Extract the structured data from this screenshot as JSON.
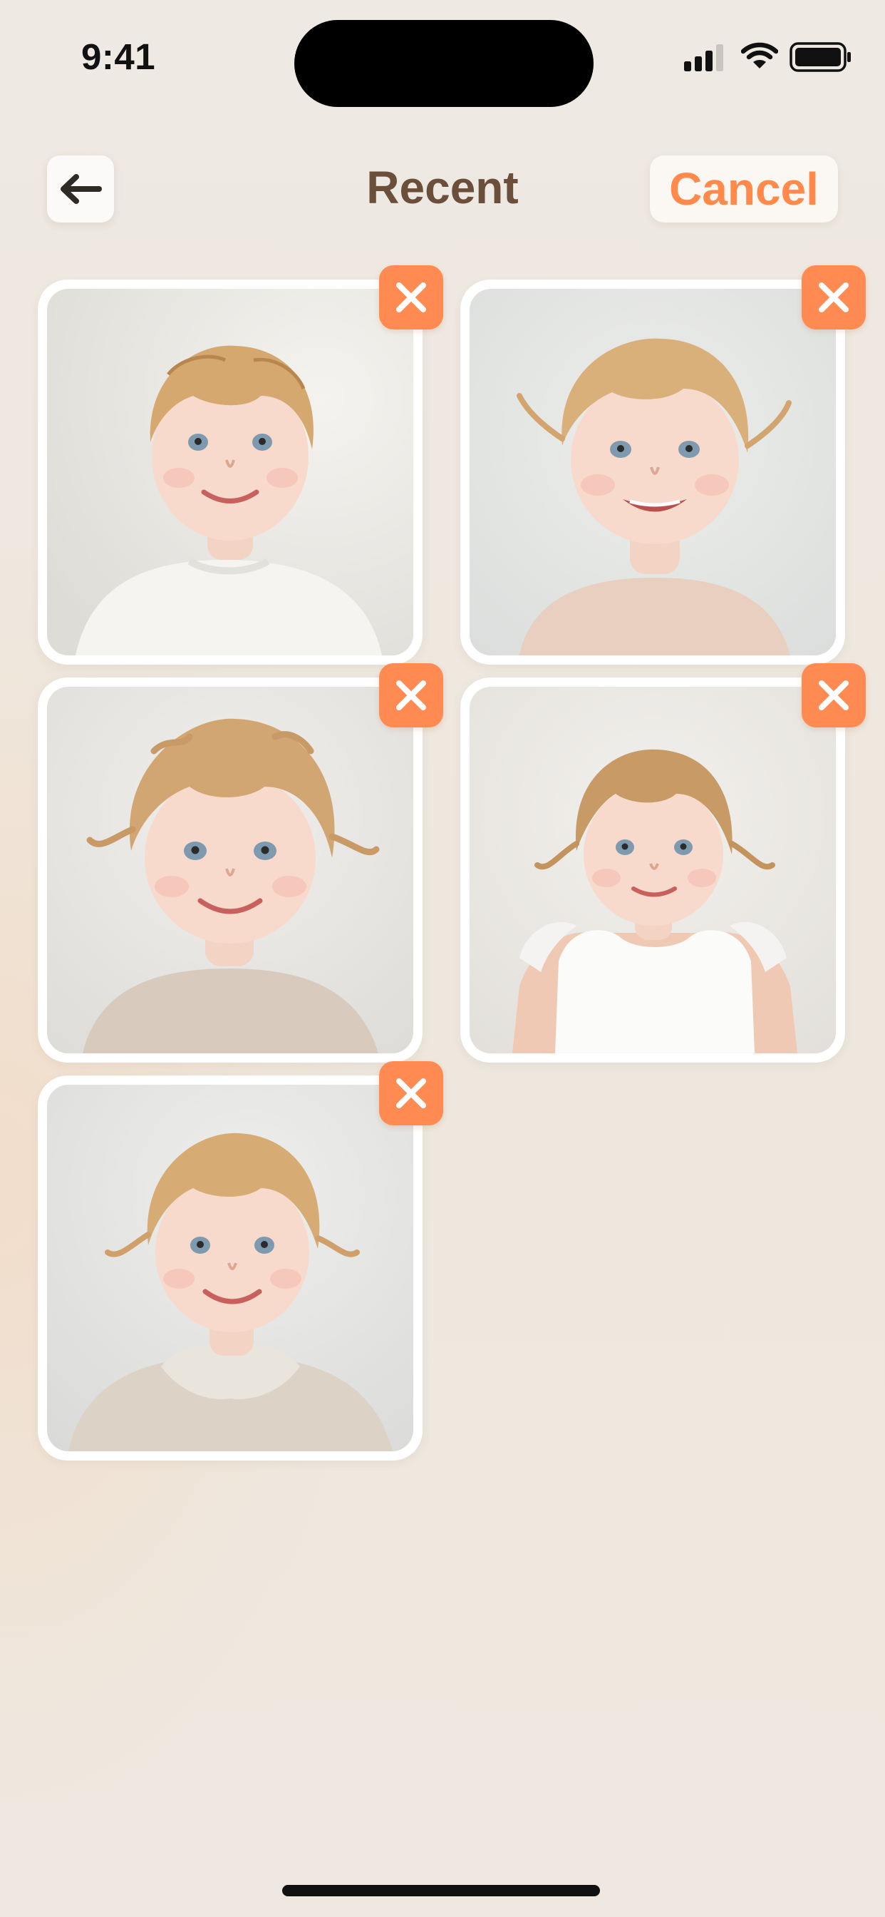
{
  "status_bar": {
    "time": "9:41",
    "icons": [
      "cellular-signal-icon",
      "wifi-icon",
      "battery-icon"
    ]
  },
  "nav": {
    "back_icon": "arrow-left-icon",
    "title": "Recent",
    "cancel_label": "Cancel"
  },
  "photos": [
    {
      "subject": "toddler",
      "remove_icon": "close-icon"
    },
    {
      "subject": "toddler",
      "remove_icon": "close-icon"
    },
    {
      "subject": "toddler",
      "remove_icon": "close-icon"
    },
    {
      "subject": "toddler",
      "remove_icon": "close-icon"
    },
    {
      "subject": "toddler",
      "remove_icon": "close-icon"
    }
  ],
  "colors": {
    "accent": "#FF8A52",
    "title": "#6B4F3A",
    "background": "#EEE8E0",
    "card_border": "#FFFFFF"
  }
}
